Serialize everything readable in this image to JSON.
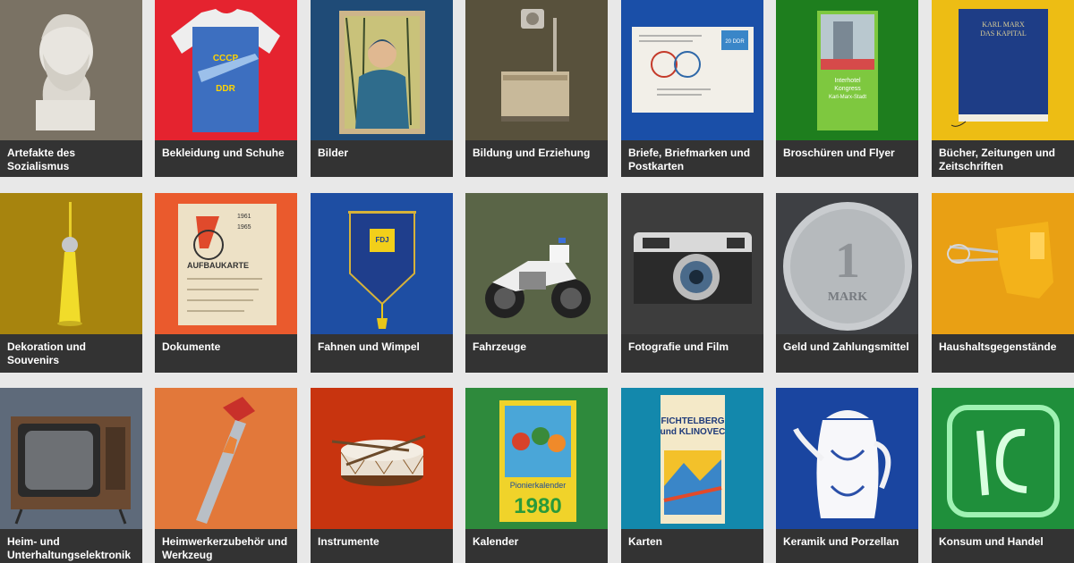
{
  "categories": [
    {
      "label": "Artefakte des Sozialismus",
      "bg": "#7a7264",
      "icon": "marx-bust-icon"
    },
    {
      "label": "Bekleidung und Schuhe",
      "bg": "#e5232f",
      "icon": "tshirt-icon",
      "print": "CCCP DDR"
    },
    {
      "label": "Bilder",
      "bg": "#1f4b77",
      "icon": "framed-painting-icon"
    },
    {
      "label": "Bildung und Erziehung",
      "bg": "#58513c",
      "icon": "overhead-projector-icon"
    },
    {
      "label": "Briefe, Briefmarken und Postkarten",
      "bg": "#1a4fa8",
      "icon": "envelope-icon",
      "stamp": "20 DDR"
    },
    {
      "label": "Broschüren und Flyer",
      "bg": "#1e7e1e",
      "icon": "brochure-icon",
      "print": "Interhotel Kongress Karl-Marx-Stadt"
    },
    {
      "label": "Bücher, Zeitungen und Zeitschriften",
      "bg": "#edbd14",
      "icon": "book-icon",
      "print": "KARL MARX DAS KAPITAL"
    },
    {
      "label": "Dekoration und Souvenirs",
      "bg": "#a7840e",
      "icon": "tv-tower-icon"
    },
    {
      "label": "Dokumente",
      "bg": "#ea5a2d",
      "icon": "document-card-icon",
      "print": "AUFBAUKARTE"
    },
    {
      "label": "Fahnen und Wimpel",
      "bg": "#1e4ea3",
      "icon": "pennant-icon",
      "print": "FDJ"
    },
    {
      "label": "Fahrzeuge",
      "bg": "#5a6547",
      "icon": "motorcycle-icon"
    },
    {
      "label": "Fotografie und Film",
      "bg": "#3d3d3d",
      "icon": "camera-icon"
    },
    {
      "label": "Geld und Zahlungsmittel",
      "bg": "#3e4044",
      "icon": "coin-icon",
      "print": "1 MARK"
    },
    {
      "label": "Haushaltsgegenstände",
      "bg": "#e9a014",
      "icon": "hand-mixer-icon"
    },
    {
      "label": "Heim- und Unterhaltungselektronik",
      "bg": "#5e6a7a",
      "icon": "television-icon"
    },
    {
      "label": "Heimwerkerzubehör und Werkzeug",
      "bg": "#e2783a",
      "icon": "saw-icon"
    },
    {
      "label": "Instrumente",
      "bg": "#c8340f",
      "icon": "drum-icon"
    },
    {
      "label": "Kalender",
      "bg": "#2e8a3c",
      "icon": "calendar-booklet-icon",
      "print": "Pionierkalender 1980"
    },
    {
      "label": "Karten",
      "bg": "#1388ac",
      "icon": "map-booklet-icon",
      "print": "FICHTELBERG und KLINOVEC"
    },
    {
      "label": "Keramik und Porzellan",
      "bg": "#1a45a0",
      "icon": "coffee-pot-icon"
    },
    {
      "label": "Konsum und Handel",
      "bg": "#1f8f3b",
      "icon": "neon-sign-icon"
    }
  ]
}
